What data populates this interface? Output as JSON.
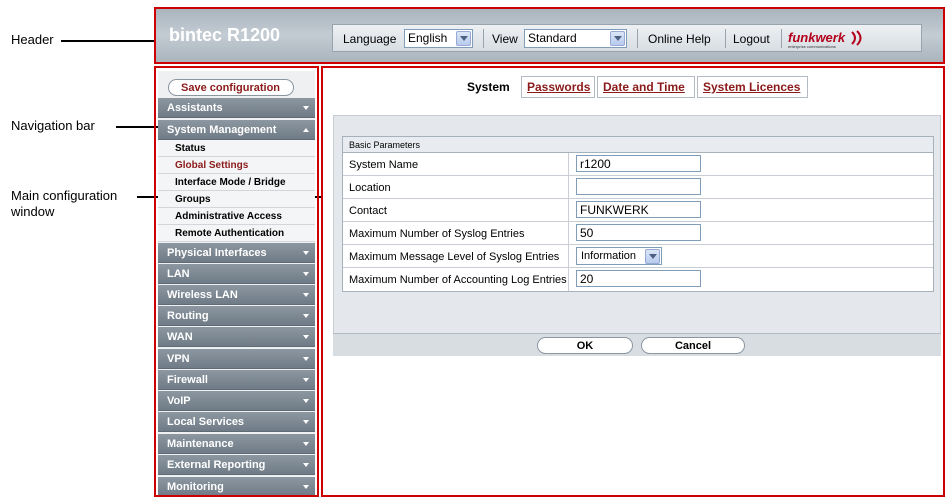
{
  "annotations": {
    "header": "Header",
    "navigation": "Navigation bar",
    "main_line1": "Main configuration",
    "main_line2": "window"
  },
  "header": {
    "brand": "bintec R1200",
    "language_label": "Language",
    "language_value": "English",
    "view_label": "View",
    "view_value": "Standard",
    "online_help": "Online Help",
    "logout": "Logout",
    "logo_text": "funkwerk",
    "logo_subtext": "enterprise communications"
  },
  "nav": {
    "save": "Save configuration",
    "menus": [
      "Assistants",
      "System Management",
      "Physical Interfaces",
      "LAN",
      "Wireless LAN",
      "Routing",
      "WAN",
      "VPN",
      "Firewall",
      "VoIP",
      "Local Services",
      "Maintenance",
      "External Reporting",
      "Monitoring"
    ],
    "sub": [
      "Status",
      "Global Settings",
      "Interface Mode / Bridge",
      "Groups",
      "Administrative Access",
      "Remote Authentication"
    ]
  },
  "main": {
    "tabs": [
      "System",
      "Passwords",
      "Date and Time",
      "System Licences"
    ],
    "section_title": "Basic Parameters",
    "rows": [
      {
        "label": "System Name",
        "value": "r1200"
      },
      {
        "label": "Location",
        "value": ""
      },
      {
        "label": "Contact",
        "value": "FUNKWERK"
      },
      {
        "label": "Maximum Number of Syslog Entries",
        "value": "50"
      },
      {
        "label": "Maximum Message Level of Syslog Entries",
        "value": "Information"
      },
      {
        "label": "Maximum Number of Accounting Log Entries",
        "value": "20"
      }
    ],
    "ok": "OK",
    "cancel": "Cancel"
  },
  "colors": {
    "frame": "#cc0000",
    "header_bg": "#b8c1c9",
    "nav_menu": "#7f8a95",
    "link": "#8b1a1a"
  }
}
